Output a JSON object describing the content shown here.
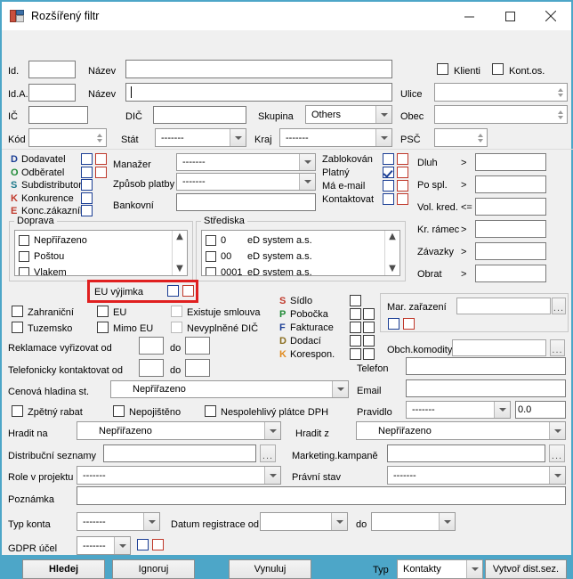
{
  "window": {
    "title": "Rozšířený filtr",
    "icon": "form-filter-icon",
    "minimize": "minimize-icon",
    "maximize": "maximize-icon",
    "close": "close-icon"
  },
  "identity": {
    "id_label": "Id.",
    "id_value": "",
    "nazev1_label": "Název",
    "nazev1_value": "",
    "ida_label": "Id.A.",
    "ida_value": "",
    "nazev2_label": "Název",
    "nazev2_value": "",
    "ic_label": "IČ",
    "ic_value": "",
    "dic_label": "DIČ",
    "dic_value": "",
    "skupina_label": "Skupina",
    "skupina_value": "Others",
    "kod_label": "Kód",
    "kod_value": "",
    "stat_label": "Stát",
    "stat_value": "-------",
    "kraj_label": "Kraj",
    "kraj_value": "-------"
  },
  "address": {
    "klienti_label": "Klienti",
    "kontos_label": "Kont.os.",
    "ulice_label": "Ulice",
    "ulice_value": "",
    "obec_label": "Obec",
    "obec_value": "",
    "psc_label": "PSČ",
    "psc_value": ""
  },
  "roles": [
    {
      "tag": "D",
      "color": "#1c3f95",
      "label": "Dodavatel",
      "boxes": 2
    },
    {
      "tag": "O",
      "color": "#1f8a36",
      "label": "Odběratel",
      "boxes": 2
    },
    {
      "tag": "S",
      "color": "#1f7a8c",
      "label": "Subdistributor",
      "boxes": 1
    },
    {
      "tag": "K",
      "color": "#c0392b",
      "label": "Konkurence",
      "boxes": 1
    },
    {
      "tag": "E",
      "color": "#c0392b",
      "label": "Konc.zákazník",
      "boxes": 1
    }
  ],
  "manager": {
    "manazer_label": "Manažer",
    "manazer_value": "-------",
    "zpusob_label": "Způsob platby",
    "zpusob_value": "-------",
    "bankovni_label": "Bankovní",
    "bankovni_value": ""
  },
  "flags": [
    {
      "label": "Zablokován",
      "checked": false
    },
    {
      "label": "Platný",
      "checked": true
    },
    {
      "label": "Má e-mail",
      "checked": false
    },
    {
      "label": "Kontaktovat",
      "checked": false
    }
  ],
  "finance": [
    {
      "label": "Dluh",
      "op": ">",
      "value": ""
    },
    {
      "label": "Po spl.",
      "op": ">",
      "value": ""
    },
    {
      "label": "Vol. kred.",
      "op": "<=",
      "value": ""
    },
    {
      "label": "Kr. rámec",
      "op": ">",
      "value": ""
    },
    {
      "label": "Závazky",
      "op": ">",
      "value": ""
    },
    {
      "label": "Obrat",
      "op": ">",
      "value": ""
    }
  ],
  "doprava": {
    "title": "Doprava",
    "items": [
      "Nepřiřazeno",
      "Poštou",
      "Vlakem"
    ],
    "scroll_up": "▲",
    "scroll_down": "▼"
  },
  "strediska": {
    "title": "Střediska",
    "items": [
      {
        "code": "0",
        "name": "eD system a.s."
      },
      {
        "code": "00",
        "name": "eD system a.s."
      },
      {
        "code": "0001",
        "name": "eD system a.s."
      }
    ],
    "scroll_up": "▲",
    "scroll_down": "▼"
  },
  "euhighlight": {
    "label": "EU výjimka",
    "highlight_color": "#e02020"
  },
  "territory": {
    "zahranicni": "Zahraniční",
    "tuzemsko": "Tuzemsko",
    "eu": "EU",
    "mimo_eu": "Mimo EU",
    "existuje_smlouva": "Existuje smlouva",
    "nevyplnene_dic": "Nevyplněné DIČ"
  },
  "addr_types": [
    {
      "tag": "S",
      "color": "#c0392b",
      "label": "Sídlo",
      "boxes": 1
    },
    {
      "tag": "P",
      "color": "#1f8a36",
      "label": "Pobočka",
      "boxes": 2
    },
    {
      "tag": "F",
      "color": "#1c3f95",
      "label": "Fakturace",
      "boxes": 2
    },
    {
      "tag": "D",
      "color": "#8a6d1f",
      "label": "Dodací",
      "boxes": 2
    },
    {
      "tag": "K",
      "color": "#e08a1e",
      "label": "Korespon.",
      "boxes": 2
    }
  ],
  "marketing": {
    "mar_zarazeni_label": "Mar. zařazení",
    "mar_zarazeni_value": "",
    "dots": "...",
    "obch_komodity_label": "Obch.komodity",
    "obch_komodity_value": ""
  },
  "contact": {
    "telefon_label": "Telefon",
    "telefon_value": "",
    "email_label": "Email",
    "email_value": "",
    "pravidlo_label": "Pravidlo",
    "pravidlo_value": "-------",
    "pravidlo_num": "0.0"
  },
  "dates": {
    "reklamace_label": "Reklamace vyřizovat od",
    "reklamace_from": "",
    "reklamace_do_label": "do",
    "reklamace_to": "",
    "telefonicky_label": "Telefonicky kontaktovat od",
    "telefonicky_from": "",
    "telefonicky_do_label": "do",
    "telefonicky_to": ""
  },
  "price": {
    "cenova_label": "Cenová hladina st.",
    "cenova_value": "Nepřiřazeno"
  },
  "misc_flags": {
    "zpetny_rabat": "Zpětný rabat",
    "nepojisteno": "Nepojištěno",
    "nespolehlivy": "Nespolehlivý plátce DPH"
  },
  "payment": {
    "hradit_na_label": "Hradit na",
    "hradit_na_value": "Nepřiřazeno",
    "hradit_z_label": "Hradit z",
    "hradit_z_value": "Nepřiřazeno"
  },
  "lists": {
    "distribucni_label": "Distribuční seznamy",
    "distribucni_value": "",
    "marketing_label": "Marketing.kampaně",
    "marketing_value": "",
    "dots": "...",
    "role_label": "Role v projektu",
    "role_value": "-------",
    "pravni_label": "Právní stav",
    "pravni_value": "-------"
  },
  "note": {
    "label": "Poznámka",
    "value": ""
  },
  "account": {
    "typ_konta_label": "Typ konta",
    "typ_konta_value": "-------",
    "datum_label": "Datum registrace od",
    "datum_from": "",
    "datum_do_label": "do",
    "datum_to": "",
    "gdpr_label": "GDPR účel",
    "gdpr_value": "-------"
  },
  "footer": {
    "hledej": "Hledej",
    "ignoruj": "Ignoruj",
    "vynuluj": "Vynuluj",
    "typ_label": "Typ",
    "typ_value": "Kontakty",
    "vytvor": "Vytvoř dist.sez."
  }
}
